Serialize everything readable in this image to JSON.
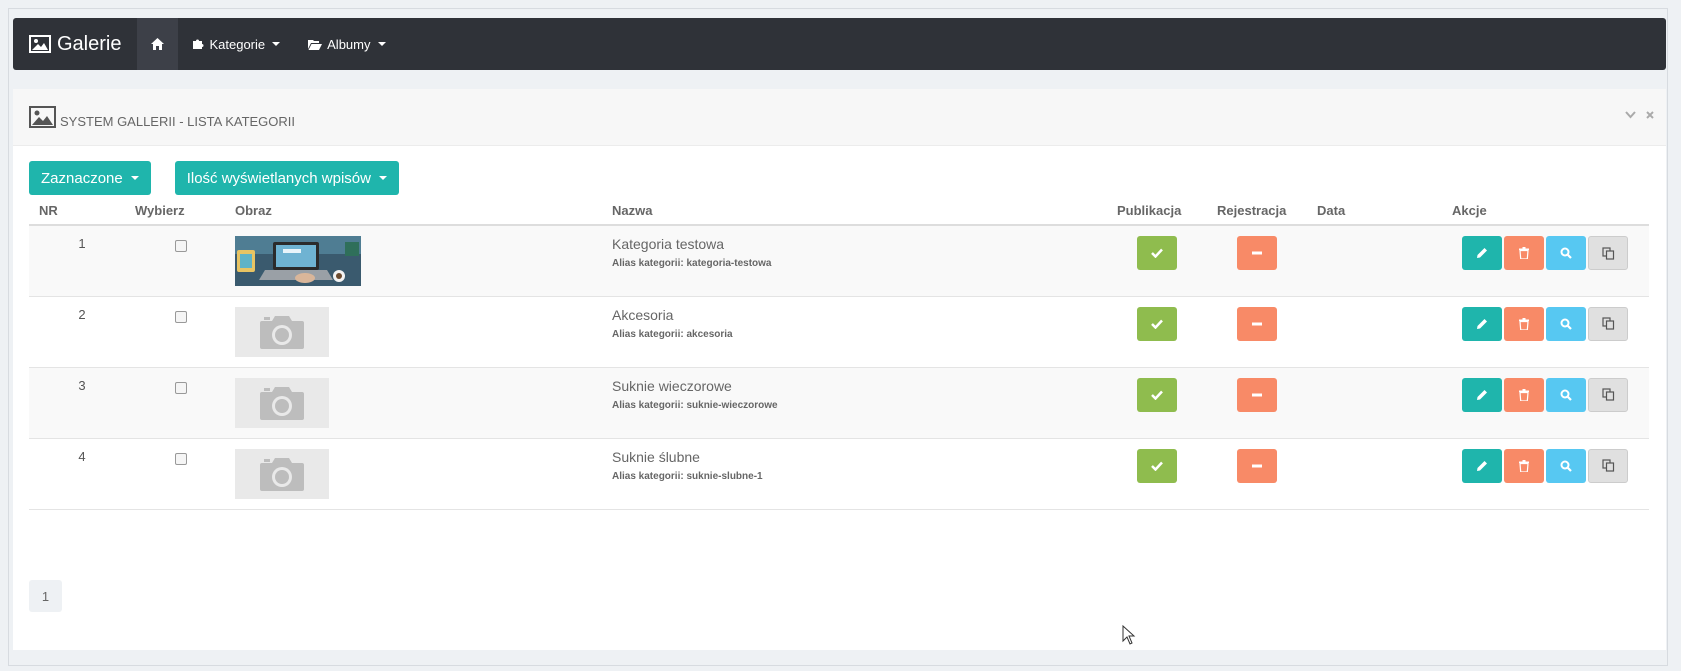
{
  "navbar": {
    "brand": "Galerie",
    "items": [
      {
        "label": "Kategorie",
        "icon": "puzzle-icon"
      },
      {
        "label": "Albumy",
        "icon": "folder-open-icon"
      }
    ]
  },
  "panel": {
    "title": "SYSTEM GALLERII - LISTA KATEGORII",
    "toolbar": {
      "selected_label": "Zaznaczone",
      "per_page_label": "Ilość wyświetlanych wpisów"
    }
  },
  "table": {
    "headers": {
      "nr": "NR",
      "select": "Wybierz",
      "image": "Obraz",
      "name": "Nazwa",
      "publication": "Publikacja",
      "registration": "Rejestracja",
      "date": "Data",
      "actions": "Akcje"
    },
    "rows": [
      {
        "nr": "1",
        "name": "Kategoria testowa",
        "alias": "Alias kategorii: kategoria-testowa",
        "image": "photo",
        "published": true,
        "registration": false
      },
      {
        "nr": "2",
        "name": "Akcesoria",
        "alias": "Alias kategorii: akcesoria",
        "image": "placeholder",
        "published": true,
        "registration": false
      },
      {
        "nr": "3",
        "name": "Suknie wieczorowe",
        "alias": "Alias kategorii: suknie-wieczorowe",
        "image": "placeholder",
        "published": true,
        "registration": false
      },
      {
        "nr": "4",
        "name": "Suknie ślubne",
        "alias": "Alias kategorii: suknie-slubne-1",
        "image": "placeholder",
        "published": true,
        "registration": false
      }
    ]
  },
  "pagination": {
    "current": "1"
  },
  "colors": {
    "navbar": "#2f3238",
    "teal": "#1fb5ac",
    "green": "#8fbc4e",
    "orange": "#f88a67",
    "blue": "#57c8f2"
  }
}
